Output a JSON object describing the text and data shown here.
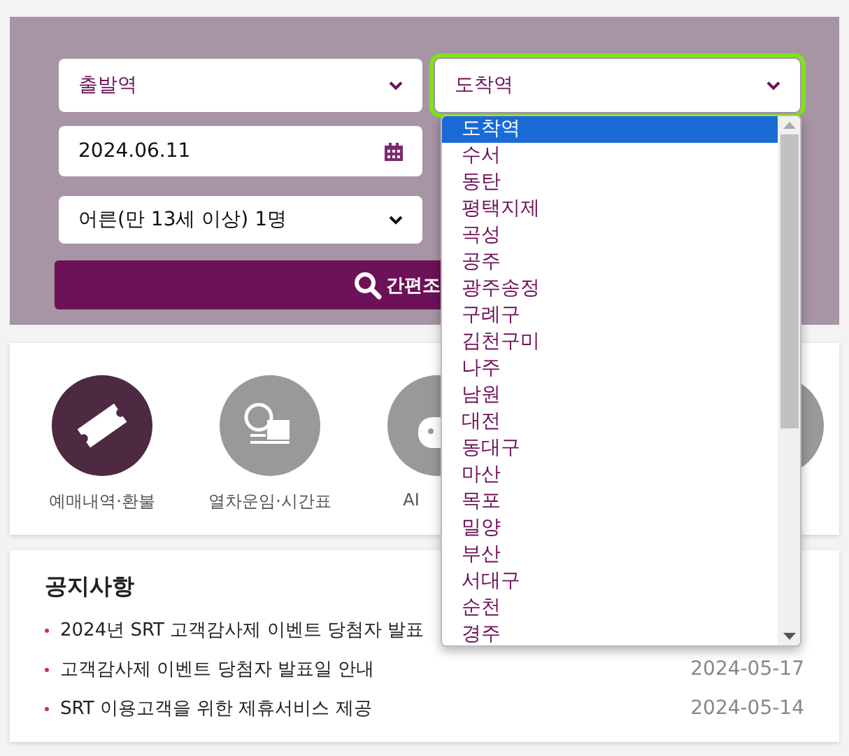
{
  "search_form": {
    "departure": {
      "value": "출발역"
    },
    "arrival": {
      "value": "도착역",
      "focused": true,
      "expanded": true
    },
    "date": {
      "value": "2024.06.11"
    },
    "passengers": {
      "value": "어른(만 13세 이상) 1명"
    },
    "search_button": {
      "label": "간편조"
    }
  },
  "arrival_options": [
    {
      "label": "도착역",
      "selected": true
    },
    {
      "label": "수서",
      "selected": false
    },
    {
      "label": "동탄",
      "selected": false
    },
    {
      "label": "평택지제",
      "selected": false
    },
    {
      "label": "곡성",
      "selected": false
    },
    {
      "label": "공주",
      "selected": false
    },
    {
      "label": "광주송정",
      "selected": false
    },
    {
      "label": "구례구",
      "selected": false
    },
    {
      "label": "김천구미",
      "selected": false
    },
    {
      "label": "나주",
      "selected": false
    },
    {
      "label": "남원",
      "selected": false
    },
    {
      "label": "대전",
      "selected": false
    },
    {
      "label": "동대구",
      "selected": false
    },
    {
      "label": "마산",
      "selected": false
    },
    {
      "label": "목포",
      "selected": false
    },
    {
      "label": "밀양",
      "selected": false
    },
    {
      "label": "부산",
      "selected": false
    },
    {
      "label": "서대구",
      "selected": false
    },
    {
      "label": "순천",
      "selected": false
    },
    {
      "label": "경주",
      "selected": false
    }
  ],
  "quick_menu": [
    {
      "kind": "ticket",
      "label": "예매내역·환불",
      "color": "#4e2942"
    },
    {
      "kind": "fare",
      "label": "열차운임·시간표",
      "color": "#999999"
    },
    {
      "kind": "chatbot",
      "label": "AI",
      "color": "#999999"
    },
    {
      "kind": "other",
      "color": "#999999"
    }
  ],
  "notices": {
    "title": "공지사항",
    "items": [
      {
        "title": "2024년 SRT 고객감사제 이벤트 당첨자 발표"
      },
      {
        "title": "고객감사제 이벤트 당첨자 발표일 안내",
        "date": "2024-05-17"
      },
      {
        "title": "SRT 이용고객을 위한 제휴서비스 제공",
        "date": "2024-05-14"
      }
    ]
  }
}
